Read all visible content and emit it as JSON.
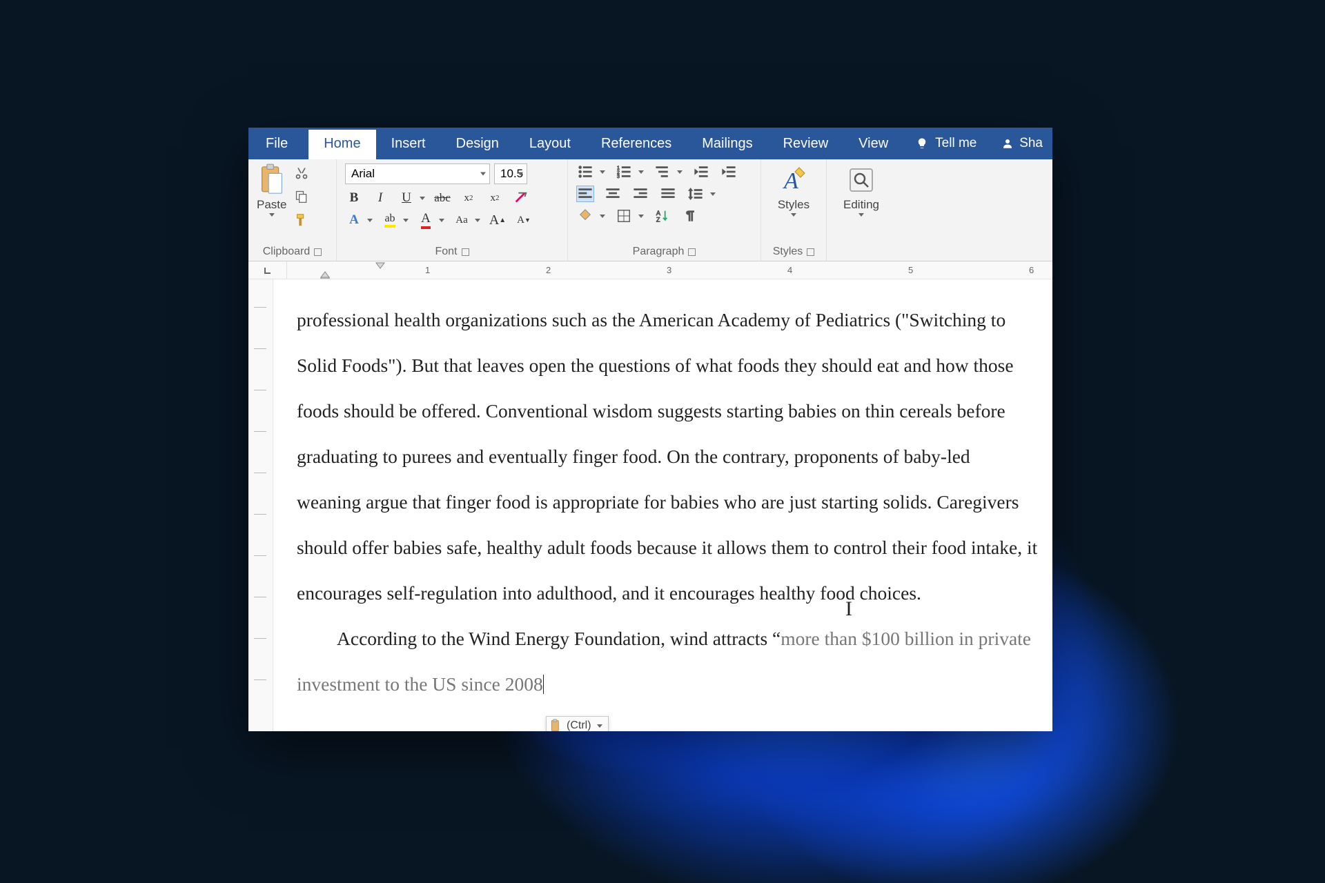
{
  "ribbon": {
    "tabs": [
      "File",
      "Home",
      "Insert",
      "Design",
      "Layout",
      "References",
      "Mailings",
      "Review",
      "View"
    ],
    "active_tab": "Home",
    "tell_me": "Tell me",
    "share": "Sha"
  },
  "clipboard": {
    "paste": "Paste",
    "label": "Clipboard"
  },
  "font": {
    "name": "Arial",
    "size": "10.5",
    "label": "Font"
  },
  "paragraph": {
    "label": "Paragraph"
  },
  "styles": {
    "label": "Styles",
    "btn": "Styles"
  },
  "editing": {
    "btn": "Editing"
  },
  "ruler_numbers": [
    "1",
    "2",
    "3",
    "4",
    "5",
    "6"
  ],
  "document": {
    "para1": "professional health organizations such as the American Academy of Pediatrics (\"Switching to Solid Foods\"). But that leaves open the questions of what foods they should eat and how those foods should be offered. Conventional wisdom suggests starting babies on thin cereals before graduating to purees and eventually finger food. On the contrary, proponents of baby-led weaning argue that finger food is appropriate for babies who are just starting solids. Caregivers should offer babies safe, healthy adult foods because it allows them to control their food intake, it encourages self-regulation into adulthood, and it encourages healthy food choices.",
    "para2_prefix": "According to the Wind Energy Foundation, wind attracts “",
    "para2_pasted": "more than $100 billion in private investment to the US since 2008"
  },
  "paste_options": {
    "label": "(Ctrl)"
  }
}
